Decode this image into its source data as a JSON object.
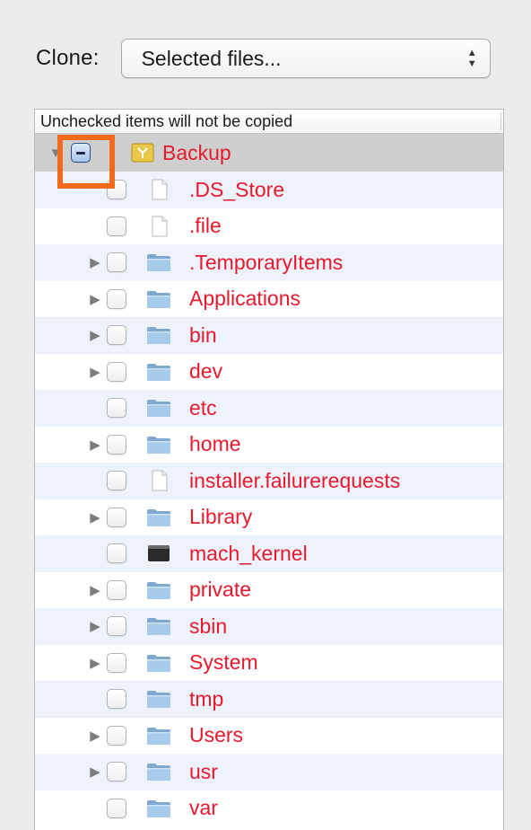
{
  "clone": {
    "label": "Clone:",
    "selected_value": "Selected files..."
  },
  "outline": {
    "header": "Unchecked items will not be copied",
    "root": {
      "name": "Backup",
      "expanded": true,
      "checkbox_state": "mixed",
      "icon": "drive-icon"
    },
    "items": [
      {
        "name": ".DS_Store",
        "type": "file",
        "icon": "file-icon",
        "expandable": false
      },
      {
        "name": ".file",
        "type": "file",
        "icon": "file-icon",
        "expandable": false
      },
      {
        "name": ".TemporaryItems",
        "type": "folder",
        "icon": "folder-icon",
        "expandable": true
      },
      {
        "name": "Applications",
        "type": "folder",
        "icon": "folder-icon",
        "expandable": true
      },
      {
        "name": "bin",
        "type": "folder",
        "icon": "folder-icon",
        "expandable": true
      },
      {
        "name": "dev",
        "type": "folder",
        "icon": "folder-icon",
        "expandable": true
      },
      {
        "name": "etc",
        "type": "folder",
        "icon": "folder-icon",
        "expandable": false
      },
      {
        "name": "home",
        "type": "folder",
        "icon": "folder-icon",
        "expandable": true
      },
      {
        "name": "installer.failurerequests",
        "type": "file",
        "icon": "file-icon",
        "expandable": false
      },
      {
        "name": "Library",
        "type": "folder",
        "icon": "folder-icon",
        "expandable": true
      },
      {
        "name": "mach_kernel",
        "type": "executable",
        "icon": "executable-icon",
        "expandable": false
      },
      {
        "name": "private",
        "type": "folder",
        "icon": "folder-icon",
        "expandable": true
      },
      {
        "name": "sbin",
        "type": "folder",
        "icon": "folder-icon",
        "expandable": true
      },
      {
        "name": "System",
        "type": "folder",
        "icon": "folder-icon",
        "expandable": true
      },
      {
        "name": "tmp",
        "type": "folder",
        "icon": "folder-icon",
        "expandable": false
      },
      {
        "name": "Users",
        "type": "folder",
        "icon": "folder-icon",
        "expandable": true
      },
      {
        "name": "usr",
        "type": "folder",
        "icon": "folder-icon",
        "expandable": true
      },
      {
        "name": "var",
        "type": "folder",
        "icon": "folder-icon",
        "expandable": false
      }
    ]
  },
  "colors": {
    "item_text": "#e8192c",
    "highlight_box": "#f26a1b",
    "alt_row": "#eef3fb",
    "selected_row": "#cfcfcf"
  }
}
